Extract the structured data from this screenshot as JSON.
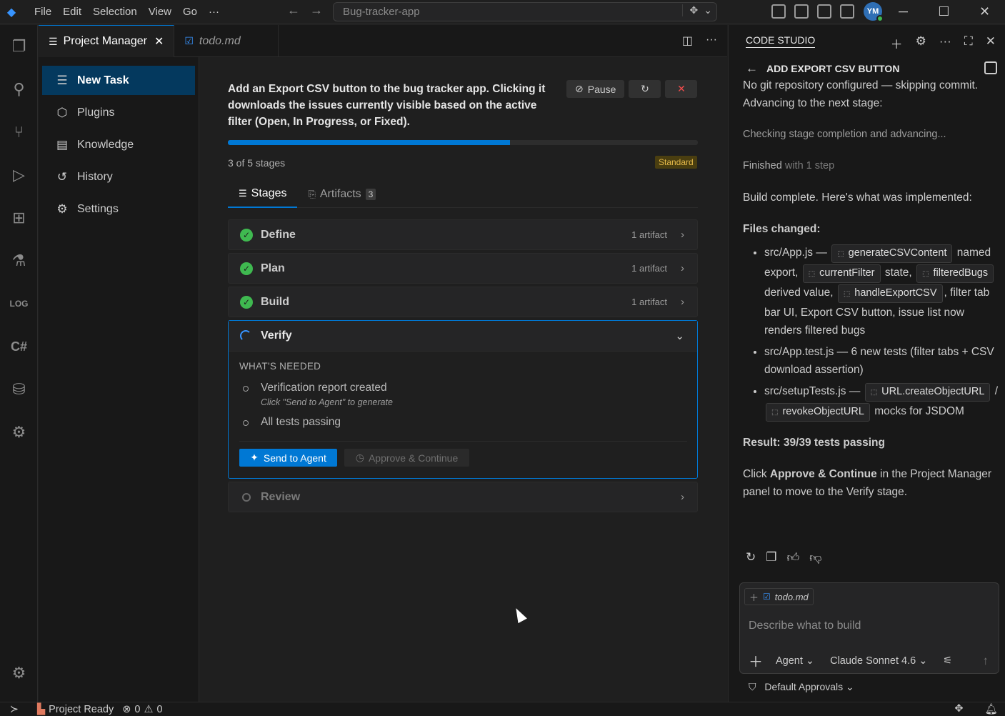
{
  "titlebar": {
    "menu": [
      "File",
      "Edit",
      "Selection",
      "View",
      "Go",
      "···"
    ],
    "search": "Bug-tracker-app",
    "avatar": "YM"
  },
  "tabs": [
    {
      "label": "Project Manager",
      "active": true
    },
    {
      "label": "todo.md",
      "active": false
    }
  ],
  "sidebar": {
    "items": [
      {
        "label": "New Task",
        "icon": "list-add-icon",
        "active": true
      },
      {
        "label": "Plugins",
        "icon": "package-icon"
      },
      {
        "label": "Knowledge",
        "icon": "book-icon"
      },
      {
        "label": "History",
        "icon": "history-icon"
      },
      {
        "label": "Settings",
        "icon": "gear-icon"
      }
    ]
  },
  "task": {
    "description": "Add an Export CSV button to the bug tracker app. Clicking it downloads the issues currently visible based on the active filter (Open, In Progress, or Fixed).",
    "pause_label": "Pause",
    "progress": 0.6,
    "stages_count": "3 of 5 stages",
    "tier": "Standard",
    "subtabs": {
      "stages": "Stages",
      "artifacts": "Artifacts",
      "artifacts_count": "3"
    }
  },
  "stages": [
    {
      "name": "Define",
      "artifacts": "1 artifact",
      "status": "done"
    },
    {
      "name": "Plan",
      "artifacts": "1 artifact",
      "status": "done"
    },
    {
      "name": "Build",
      "artifacts": "1 artifact",
      "status": "done"
    },
    {
      "name": "Verify",
      "status": "active"
    },
    {
      "name": "Review",
      "status": "pending"
    }
  ],
  "verify": {
    "needed_heading": "WHAT'S NEEDED",
    "req1": "Verification report created",
    "req1_hint": "Click \"Send to Agent\" to generate",
    "req2": "All tests passing",
    "send_label": "Send to Agent",
    "approve_label": "Approve & Continue"
  },
  "chat": {
    "title": "CODE STUDIO",
    "subtitle": "ADD EXPORT CSV BUTTON",
    "msg1": "No git repository configured — skipping commit. Advancing to the next stage:",
    "msg2": "Checking stage completion and advancing...",
    "msg3_a": "Finished",
    "msg3_b": " with 1 step",
    "msg4": "Build complete. Here's what was implemented:",
    "files_heading": "Files changed:",
    "f1_path": "src/App.js — ",
    "f1_c1": "generateCSVContent",
    "f1_t1": " named export, ",
    "f1_c2": "currentFilter",
    "f1_t2": " state, ",
    "f1_c3": "filteredBugs",
    "f1_t3": " derived value, ",
    "f1_c4": "handleExportCSV",
    "f1_t4": ", filter tab bar UI, Export CSV button, issue list now renders filtered bugs",
    "f2": "src/App.test.js — 6 new tests (filter tabs + CSV download assertion)",
    "f3_path": "src/setupTests.js — ",
    "f3_c1": "URL.createObjectURL",
    "f3_t1": " / ",
    "f3_c2": "revokeObjectURL",
    "f3_t2": " mocks for JSDOM",
    "result": "Result: 39/39 tests passing",
    "final_a": "Click ",
    "final_b": "Approve & Continue",
    "final_c": " in the Project Manager panel to move to the Verify stage.",
    "composer": {
      "context_file": "todo.md",
      "placeholder": "Describe what to build",
      "mode": "Agent",
      "model": "Claude Sonnet 4.6"
    },
    "approvals": "Default Approvals"
  },
  "status": {
    "project": "Project Ready",
    "errors": "0",
    "warnings": "0"
  }
}
